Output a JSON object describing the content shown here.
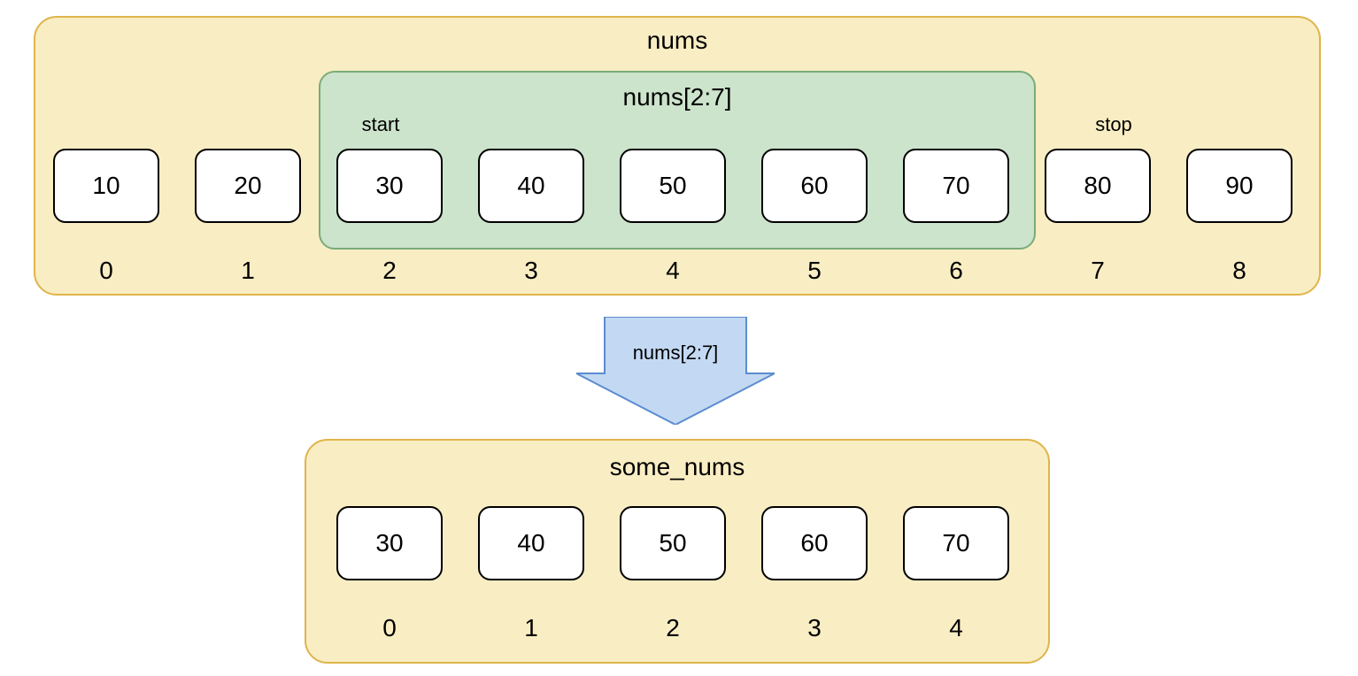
{
  "top": {
    "name": "nums",
    "slice_expr": "nums[2:7]",
    "start_label": "start",
    "stop_label": "stop",
    "values": [
      "10",
      "20",
      "30",
      "40",
      "50",
      "60",
      "70",
      "80",
      "90"
    ],
    "indices": [
      "0",
      "1",
      "2",
      "3",
      "4",
      "5",
      "6",
      "7",
      "8"
    ]
  },
  "arrow": {
    "label": "nums[2:7]"
  },
  "bottom": {
    "name": "some_nums",
    "values": [
      "30",
      "40",
      "50",
      "60",
      "70"
    ],
    "indices": [
      "0",
      "1",
      "2",
      "3",
      "4"
    ]
  },
  "colors": {
    "yellow_fill": "#f9edc3",
    "yellow_border": "#dfb54a",
    "green_fill": "#cce3cc",
    "green_border": "#7aab7a",
    "blue_fill": "#c3d9f3",
    "blue_border": "#5b8ccf"
  }
}
